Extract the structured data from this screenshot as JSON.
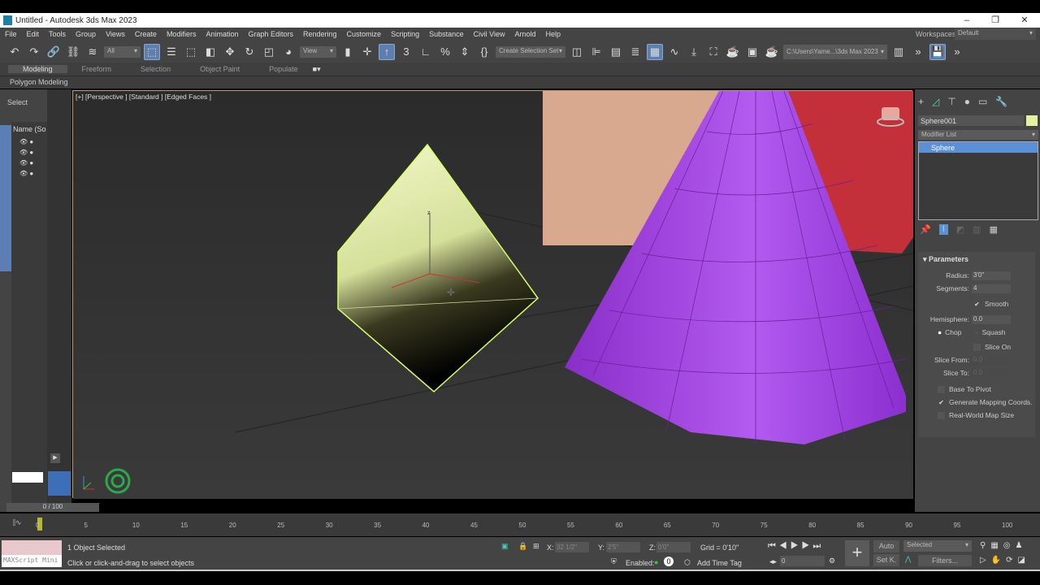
{
  "window": {
    "title": "Untitled - Autodesk 3ds Max 2023",
    "minimize": "–",
    "maximize": "❐",
    "close": "✕"
  },
  "menu": [
    "File",
    "Edit",
    "Tools",
    "Group",
    "Views",
    "Create",
    "Modifiers",
    "Animation",
    "Graph Editors",
    "Rendering",
    "Customize",
    "Scripting",
    "Substance",
    "Civil View",
    "Arnold",
    "Help"
  ],
  "workspaces": {
    "label": "Workspaces:",
    "value": "Default"
  },
  "toolbar": {
    "filter": "All",
    "view": "View",
    "selection_set": "Create Selection Set",
    "project_path": "C:\\Users\\Yame...\\3ds Max 2023"
  },
  "ribbon": {
    "tabs": [
      "Modeling",
      "Freeform",
      "Selection",
      "Object Paint",
      "Populate"
    ],
    "active": "Modeling",
    "sub": "Polygon Modeling"
  },
  "scene_explorer": {
    "title": "Select",
    "column": "Name (So"
  },
  "viewport": {
    "label": "[+] [Perspective ] [Standard ] [Edged Faces ]"
  },
  "command_panel": {
    "object_name": "Sphere001",
    "object_color": "#e4f2a0",
    "modifier_list": "Modifier List",
    "stack": [
      "Sphere"
    ],
    "rollout": "Parameters",
    "radius_label": "Radius:",
    "radius": "3'0\"",
    "segments_label": "Segments:",
    "segments": "4",
    "smooth": "Smooth",
    "hemisphere_label": "Hemisphere:",
    "hemisphere": "0.0",
    "chop": "Chop",
    "squash": "Squash",
    "slice_on": "Slice On",
    "slice_from_label": "Slice From:",
    "slice_from": "0.0",
    "slice_to_label": "Slice To:",
    "slice_to": "0.0",
    "base_to_pivot": "Base To Pivot",
    "gen_mapping": "Generate Mapping Coords.",
    "real_world": "Real-World Map Size"
  },
  "timeline": {
    "frame": "0 / 100",
    "ticks": [
      "0",
      "5",
      "10",
      "15",
      "20",
      "25",
      "30",
      "35",
      "40",
      "45",
      "50",
      "55",
      "60",
      "65",
      "70",
      "75",
      "80",
      "85",
      "90",
      "95",
      "100"
    ]
  },
  "status": {
    "maxscript": "MAXScript Mini",
    "selected": "1 Object Selected",
    "prompt": "Click or click-and-drag to select objects",
    "x_label": "X:",
    "x": "32 1/2\"",
    "y_label": "Y:",
    "y": "2'5\"",
    "z_label": "Z:",
    "z": "0'0\"",
    "grid": "Grid = 0'10\"",
    "enabled": "Enabled:",
    "add_time_tag": "Add Time Tag",
    "current_frame": "0",
    "auto": "Auto",
    "set_key": "Set K.",
    "key_filter": "Selected",
    "filters": "Filters..."
  }
}
